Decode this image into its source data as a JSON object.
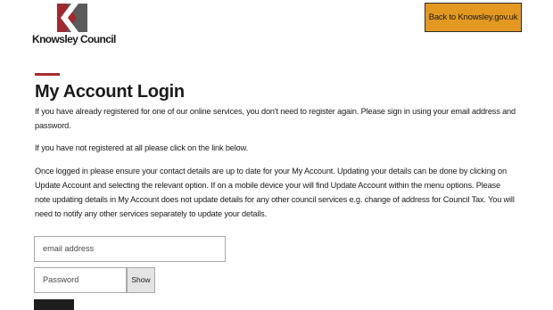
{
  "header": {
    "logo_text": "Knowsley Council",
    "back_button_label": "Back to Knowsley.gov.uk"
  },
  "main": {
    "title": "My Account Login",
    "paragraphs": [
      "If you have already registered for one of our online services, you don't need to register again. Please sign in using your email address and password.",
      "If you have not registered at all please click on the link below.",
      "Once logged in please ensure your contact details are up to date for your My Account. Updating your details can be done by clicking on Update Account and selecting the relevant option. If on a mobile device your will find Update Account within the menu options. Please note updating details in My Account does not update details for any other council services e.g. change of address for Council Tax. You will need to notify any other services separately to update your details."
    ]
  },
  "form": {
    "email_placeholder": "email address",
    "password_placeholder": "Password",
    "show_button_label": "Show"
  },
  "colors": {
    "brand_red": "#a32e2e",
    "button_orange": "#e39821"
  }
}
